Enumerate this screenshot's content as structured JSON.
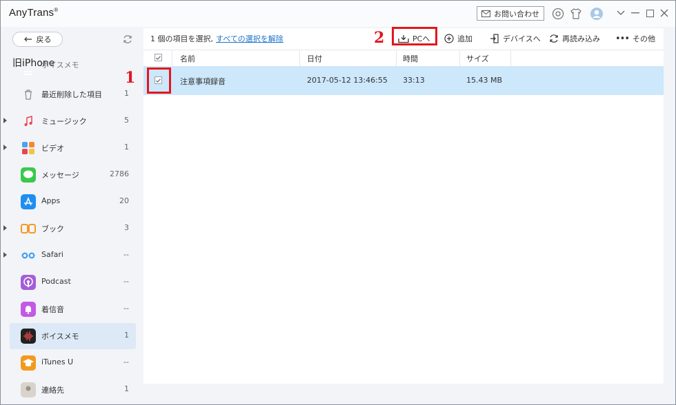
{
  "app": {
    "title": "AnyTrans",
    "reg_mark": "®"
  },
  "titlebar": {
    "contact_label": "お問い合わせ"
  },
  "sidebar": {
    "back_label": "戻る",
    "device_name": "旧iPhone",
    "items": [
      {
        "label": "ボイスメモ",
        "count": "",
        "partial": true,
        "icon": "lines-icon",
        "color": "#f1a24a",
        "expandable": false
      },
      {
        "label": "最近削除した項目",
        "count": "1",
        "icon": "trash-icon",
        "color": "#9a9a9a",
        "expandable": false
      },
      {
        "label": "ミュージック",
        "count": "5",
        "icon": "music-icon",
        "color": "#e8454f",
        "expandable": true
      },
      {
        "label": "ビデオ",
        "count": "1",
        "icon": "video-icon",
        "color": "#f28a30",
        "expandable": true
      },
      {
        "label": "メッセージ",
        "count": "2786",
        "icon": "message-icon",
        "color": "#3ac94a",
        "expandable": false
      },
      {
        "label": "Apps",
        "count": "20",
        "icon": "app-store-icon",
        "color": "#1f8ef0",
        "expandable": false
      },
      {
        "label": "ブック",
        "count": "3",
        "icon": "book-icon",
        "color": "#f59a23",
        "expandable": true
      },
      {
        "label": "Safari",
        "count": "--",
        "icon": "safari-icon",
        "color": "#4aa3f0",
        "expandable": true
      },
      {
        "label": "Podcast",
        "count": "--",
        "icon": "podcast-icon",
        "color": "#a55ed8",
        "expandable": false
      },
      {
        "label": "着信音",
        "count": "--",
        "icon": "bell-icon",
        "color": "#c25ae6",
        "expandable": false
      },
      {
        "label": "ボイスメモ",
        "count": "1",
        "icon": "voice-memo-icon",
        "color": "#222222",
        "expandable": false,
        "active": true
      },
      {
        "label": "iTunes U",
        "count": "--",
        "icon": "itunes-u-icon",
        "color": "#f29a1f",
        "expandable": false
      },
      {
        "label": "連絡先",
        "count": "1",
        "icon": "contacts-icon",
        "color": "#b8b2a8",
        "expandable": false
      }
    ]
  },
  "main": {
    "selection_text": "1 個の項目を選択,",
    "deselect_link": "すべての選択を解除",
    "toolbar": {
      "to_pc": "PCへ",
      "add": "追加",
      "to_device": "デバイスへ",
      "reload": "再読み込み",
      "more": "その他"
    },
    "columns": {
      "name": "名前",
      "date": "日付",
      "time": "時間",
      "size": "サイズ"
    },
    "rows": [
      {
        "name": "注意事項録音",
        "date": "2017-05-12 13:46:55",
        "time": "33:13",
        "size": "15.43 MB",
        "checked": true
      }
    ]
  },
  "annotations": {
    "step1": "1",
    "step2": "2"
  },
  "colors": {
    "highlight": "#e4161d",
    "selected_row": "#cde7fb",
    "link": "#1a73c9",
    "active_nav": "#dde9f6"
  }
}
